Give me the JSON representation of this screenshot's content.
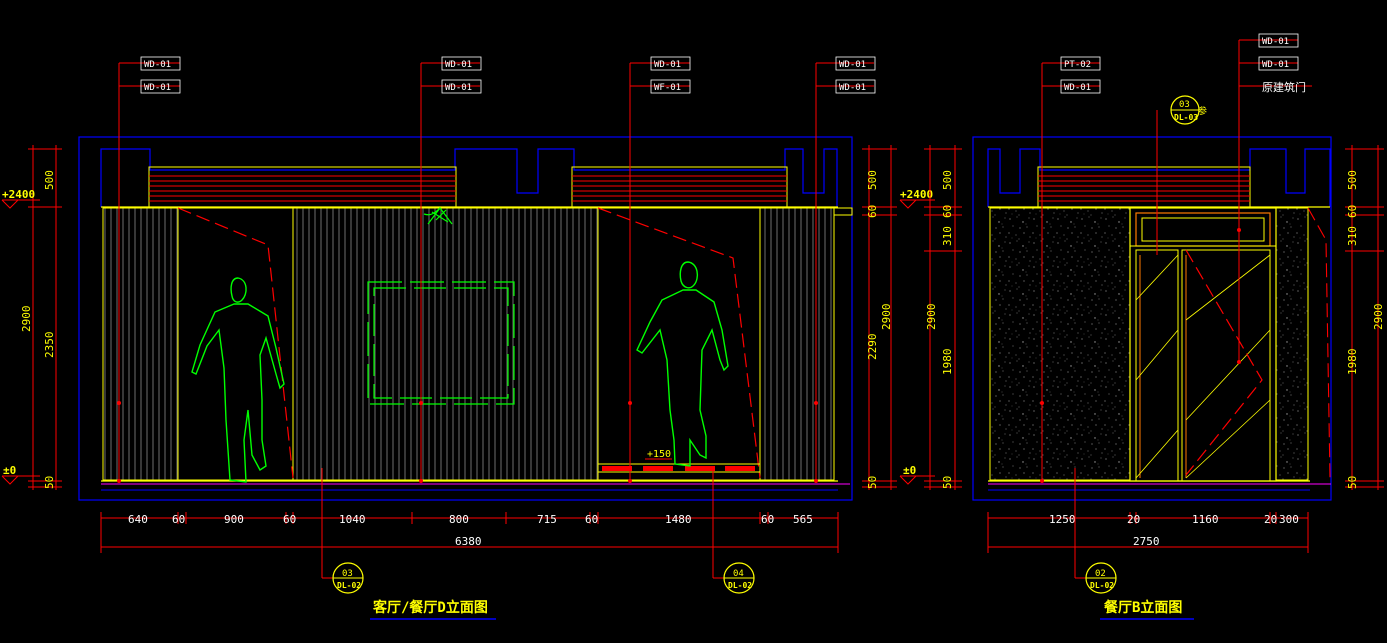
{
  "colors": {
    "background": "#000000",
    "red": "#ff0000",
    "yellow": "#ffff00",
    "blue": "#0000ff",
    "green": "#00ff00",
    "white": "#ffffff",
    "magenta": "#ff00ff",
    "orange": "#ff7a00"
  },
  "left_elevation": {
    "title": "客厅/餐厅D立面图",
    "level_top": "+2400",
    "level_zero": "±0",
    "level_step": "+150",
    "callout_tags": [
      {
        "top": "WD-01",
        "bottom": "WD-01"
      },
      {
        "top": "WD-01",
        "bottom": "WD-01"
      },
      {
        "top": "WD-01",
        "bottom": "WF-01"
      },
      {
        "top": "WD-01",
        "bottom": "WD-01"
      }
    ],
    "left_dims": [
      "500",
      "2900",
      "2350",
      "50"
    ],
    "right_dims": [
      "500",
      "60",
      "2900",
      "2290",
      "50"
    ],
    "bottom_dims": [
      "640",
      "60",
      "900",
      "60",
      "1040",
      "800",
      "715",
      "60",
      "1480",
      "60",
      "565"
    ],
    "total_dim": "6380",
    "section_marks": [
      {
        "num": "03",
        "ref": "DL-02"
      },
      {
        "num": "04",
        "ref": "DL-02"
      }
    ]
  },
  "right_elevation": {
    "title": "餐厅B立面图",
    "level_top": "+2400",
    "level_zero": "±0",
    "callout_tags": [
      {
        "top": "PT-02",
        "bottom": "WD-01"
      },
      {
        "top": "WD-01",
        "middle": "WD-01",
        "bottom": "原建筑门"
      }
    ],
    "detail_mark": {
      "num": "03",
      "ref": "DL-03",
      "suffix": "参"
    },
    "left_dims": [
      "500",
      "60",
      "310",
      "2900",
      "1980",
      "50"
    ],
    "right_dims": [
      "500",
      "60",
      "310",
      "2900",
      "1980",
      "50"
    ],
    "bottom_dims": [
      "1250",
      "20",
      "1160",
      "20",
      "300"
    ],
    "total_dim": "2750",
    "section_mark": {
      "num": "02",
      "ref": "DL-02"
    }
  }
}
